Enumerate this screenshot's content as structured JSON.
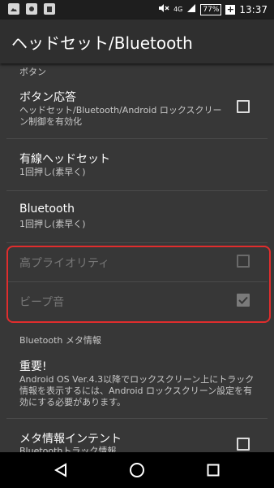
{
  "status_bar": {
    "network": "4G",
    "battery": "77%",
    "time": "13:37",
    "icons": [
      "gallery-icon",
      "photo-icon",
      "clipboard-icon",
      "mute-icon",
      "signal-icon",
      "battery-icon",
      "charging-icon"
    ]
  },
  "app_bar": {
    "title": "ヘッドセット/Bluetooth"
  },
  "sections": {
    "buttons_header": "ボタン",
    "bluetooth_meta_header": "Bluetooth メタ情報"
  },
  "items": {
    "button_response": {
      "title": "ボタン応答",
      "summary_line1": "ヘッドセット/Bluetooth/Android ロックスクリー",
      "summary_line2": "ン制御を有効化",
      "checked": false
    },
    "wired_headset": {
      "title": "有線ヘッドセット",
      "summary": "1回押し(素早く)"
    },
    "bluetooth": {
      "title": "Bluetooth",
      "summary": "1回押し(素早く)"
    },
    "high_priority": {
      "title": "高プライオリティ",
      "enabled": false,
      "checked": false
    },
    "beep": {
      "title": "ビープ音",
      "enabled": false,
      "checked": true
    },
    "important": {
      "title": "重要!",
      "line1": "Android OS Ver.4.3以降でロックスクリーン上にトラック",
      "line2": "情報を表示するには、Android ロックスクリーン設定を有",
      "line3": "効にする必要があります。"
    },
    "meta_intent": {
      "title": "メタ情報インテント",
      "summary": "Bluetoothトラック情報",
      "checked": false
    }
  },
  "colors": {
    "highlight_border": "#e02d2d",
    "app_bar": "#2f2f2f",
    "background": "#373737"
  }
}
